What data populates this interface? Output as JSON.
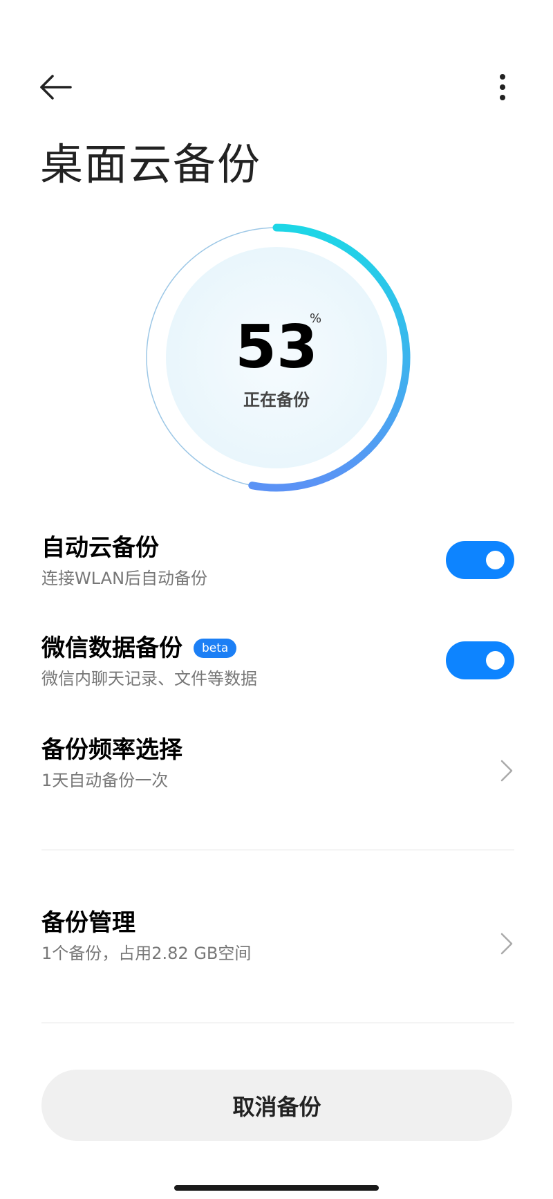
{
  "header": {
    "back_icon": "arrow-left-icon",
    "more_icon": "more-vertical-icon",
    "title": "桌面云备份"
  },
  "progress": {
    "value": "53",
    "unit": "%",
    "fraction": 0.53,
    "status": "正在备份"
  },
  "settings": {
    "auto_backup": {
      "title": "自动云备份",
      "subtitle": "连接WLAN后自动备份",
      "enabled": true
    },
    "wechat_backup": {
      "title": "微信数据备份",
      "badge": "beta",
      "subtitle": "微信内聊天记录、文件等数据",
      "enabled": true
    },
    "frequency": {
      "title": "备份频率选择",
      "subtitle": "1天自动备份一次"
    },
    "management": {
      "title": "备份管理",
      "subtitle": "1个备份，占用2.82 GB空间"
    }
  },
  "cancel_button": {
    "label": "取消备份"
  },
  "colors": {
    "accent": "#0d84ff",
    "ring_start": "#1dd6e6",
    "ring_end": "#5b92f5",
    "badge": "#1c7ff5"
  }
}
